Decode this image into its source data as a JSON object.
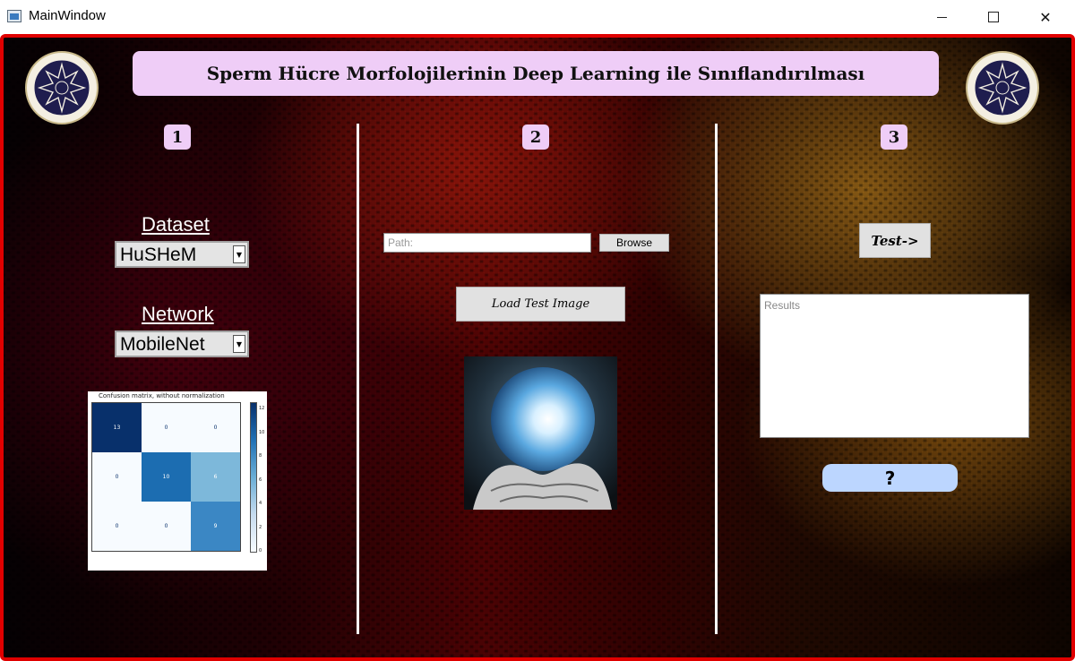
{
  "window": {
    "title": "MainWindow",
    "minimize_icon": "minimize-icon",
    "maximize_icon": "maximize-icon",
    "close_glyph": "✕"
  },
  "header": {
    "title": "Sperm Hücre Morfolojilerinin Deep Learning ile Sınıflandırılması",
    "logo_icon": "university-seal-icon"
  },
  "steps": [
    "1",
    "2",
    "3"
  ],
  "column1": {
    "dataset_label": "Dataset",
    "dataset_value": "HuSHeM",
    "network_label": "Network",
    "network_value": "MobileNet",
    "confusion_matrix": {
      "title": "Confusion matrix, without normalization",
      "rows": [
        [
          "13",
          "0",
          "0"
        ],
        [
          "0",
          "10",
          "6"
        ],
        [
          "0",
          "0",
          "9"
        ]
      ],
      "colorbar_ticks": [
        "12",
        "10",
        "8",
        "6",
        "4",
        "2",
        "0"
      ]
    }
  },
  "column2": {
    "path_placeholder": "Path:",
    "path_value": "",
    "browse_label": "Browse",
    "load_label": "Load Test Image"
  },
  "column3": {
    "test_label": "Test->",
    "results_placeholder": "Results",
    "help_label": "?"
  },
  "colors": {
    "header_bg": "#efcdf7",
    "frame_border": "#e00000",
    "help_button_bg": "#bcd6ff"
  }
}
